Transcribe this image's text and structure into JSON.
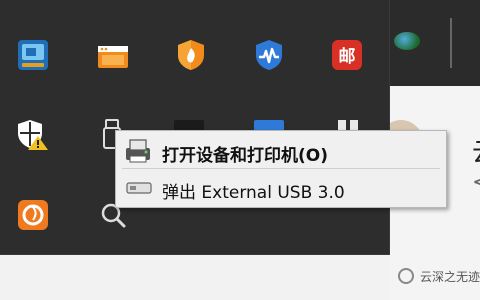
{
  "context_menu": {
    "items": [
      {
        "label": "打开设备和打印机(O)",
        "default": true
      },
      {
        "label": "弹出 External USB 3.0",
        "default": false
      }
    ]
  },
  "background_window": {
    "title_fragment": "云",
    "chevron": "<"
  },
  "watermark": {
    "text": "云深之无迹"
  },
  "tray_icons": [
    "control-panel-icon",
    "window-icon",
    "shield-fire-icon",
    "network-monitor-icon",
    "mail-app-icon",
    "defender-warning-icon",
    "usb-device-icon",
    "search-icon",
    "flame-app-icon"
  ],
  "colors": {
    "tray_bg": "#2d2d2d",
    "menu_bg": "#f0f0f0",
    "accent_orange": "#f28b1c",
    "accent_blue": "#2f7ad8",
    "accent_red": "#d93025"
  }
}
